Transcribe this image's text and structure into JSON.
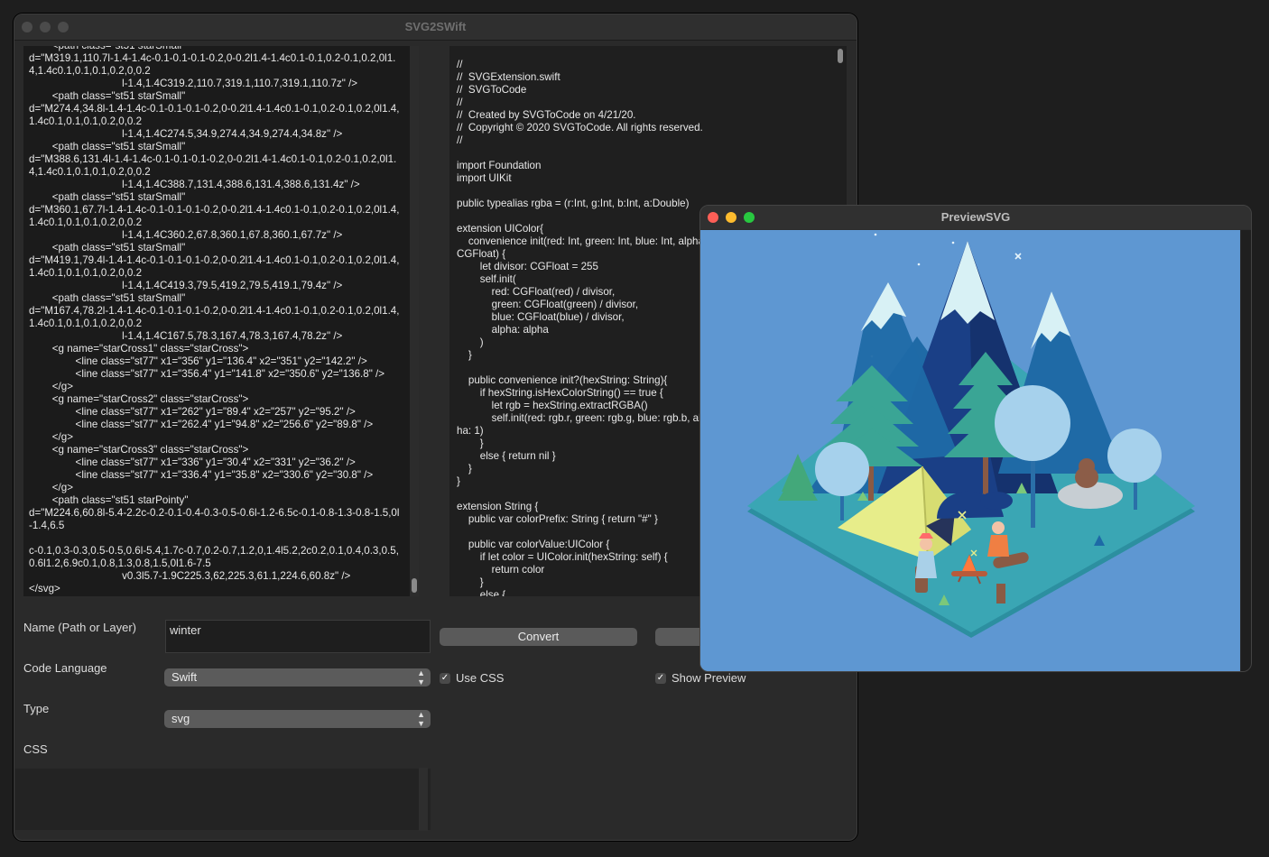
{
  "main_window": {
    "title": "SVG2SWift"
  },
  "svg_source": {
    "text": "\t<path class=\"st51 starSmall\"\nd=\"M319.1,110.7l-1.4-1.4c-0.1-0.1-0.1-0.2,0-0.2l1.4-1.4c0.1-0.1,0.2-0.1,0.2,0l1.4,1.4c0.1,0.1,0.1,0.2,0,0.2\n\t\t\t\tl-1.4,1.4C319.2,110.7,319.1,110.7,319.1,110.7z\" />\n\t<path class=\"st51 starSmall\"\nd=\"M274.4,34.8l-1.4-1.4c-0.1-0.1-0.1-0.2,0-0.2l1.4-1.4c0.1-0.1,0.2-0.1,0.2,0l1.4,1.4c0.1,0.1,0.1,0.2,0,0.2\n\t\t\t\tl-1.4,1.4C274.5,34.9,274.4,34.9,274.4,34.8z\" />\n\t<path class=\"st51 starSmall\"\nd=\"M388.6,131.4l-1.4-1.4c-0.1-0.1-0.1-0.2,0-0.2l1.4-1.4c0.1-0.1,0.2-0.1,0.2,0l1.4,1.4c0.1,0.1,0.1,0.2,0,0.2\n\t\t\t\tl-1.4,1.4C388.7,131.4,388.6,131.4,388.6,131.4z\" />\n\t<path class=\"st51 starSmall\"\nd=\"M360.1,67.7l-1.4-1.4c-0.1-0.1-0.1-0.2,0-0.2l1.4-1.4c0.1-0.1,0.2-0.1,0.2,0l1.4,1.4c0.1,0.1,0.1,0.2,0,0.2\n\t\t\t\tl-1.4,1.4C360.2,67.8,360.1,67.8,360.1,67.7z\" />\n\t<path class=\"st51 starSmall\"\nd=\"M419.1,79.4l-1.4-1.4c-0.1-0.1-0.1-0.2,0-0.2l1.4-1.4c0.1-0.1,0.2-0.1,0.2,0l1.4,1.4c0.1,0.1,0.1,0.2,0,0.2\n\t\t\t\tl-1.4,1.4C419.3,79.5,419.2,79.5,419.1,79.4z\" />\n\t<path class=\"st51 starSmall\"\nd=\"M167.4,78.2l-1.4-1.4c-0.1-0.1-0.1-0.2,0-0.2l1.4-1.4c0.1-0.1,0.2-0.1,0.2,0l1.4,1.4c0.1,0.1,0.1,0.2,0,0.2\n\t\t\t\tl-1.4,1.4C167.5,78.3,167.4,78.3,167.4,78.2z\" />\n\t<g name=\"starCross1\" class=\"starCross\">\n\t\t<line class=\"st77\" x1=\"356\" y1=\"136.4\" x2=\"351\" y2=\"142.2\" />\n\t\t<line class=\"st77\" x1=\"356.4\" y1=\"141.8\" x2=\"350.6\" y2=\"136.8\" />\n\t</g>\n\t<g name=\"starCross2\" class=\"starCross\">\n\t\t<line class=\"st77\" x1=\"262\" y1=\"89.4\" x2=\"257\" y2=\"95.2\" />\n\t\t<line class=\"st77\" x1=\"262.4\" y1=\"94.8\" x2=\"256.6\" y2=\"89.8\" />\n\t</g>\n\t<g name=\"starCross3\" class=\"starCross\">\n\t\t<line class=\"st77\" x1=\"336\" y1=\"30.4\" x2=\"331\" y2=\"36.2\" />\n\t\t<line class=\"st77\" x1=\"336.4\" y1=\"35.8\" x2=\"330.6\" y2=\"30.8\" />\n\t</g>\n\t<path class=\"st51 starPointy\"\nd=\"M224.6,60.8l-5.4-2.2c-0.2-0.1-0.4-0.3-0.5-0.6l-1.2-6.5c-0.1-0.8-1.3-0.8-1.5,0l-1.4,6.5\n\nc-0.1,0.3-0.3,0.5-0.5,0.6l-5.4,1.7c-0.7,0.2-0.7,1.2,0,1.4l5.2,2c0.2,0.1,0.4,0.3,0.5,0.6l1.2,6.9c0.1,0.8,1.3,0.8,1.5,0l1.6-7.5\n\t\t\t\tv0.3l5.7-1.9C225.3,62,225.3,61.1,224.6,60.8z\" />\n</svg>"
  },
  "swift_output": {
    "text": "//\n//  SVGExtension.swift\n//  SVGToCode\n//\n//  Created by SVGToCode on 4/21/20.\n//  Copyright © 2020 SVGToCode. All rights reserved.\n//\n\nimport Foundation\nimport UIKit\n\npublic typealias rgba = (r:Int, g:Int, b:Int, a:Double)\n\nextension UIColor{\n    convenience init(red: Int, green: Int, blue: Int, alpha:CGFloat) {\n        let divisor: CGFloat = 255\n        self.init(\n            red: CGFloat(red) / divisor,\n            green: CGFloat(green) / divisor,\n            blue: CGFloat(blue) / divisor,\n            alpha: alpha\n        )\n    }\n\n    public convenience init?(hexString: String){\n        if hexString.isHexColorString() == true {\n            let rgb = hexString.extractRGBA()\n            self.init(red: rgb.r, green: rgb.g, blue: rgb.b, alpha: 1)\n        }\n        else { return nil }\n    }\n}\n\nextension String {\n    public var colorPrefix: String { return \"#\" }\n\n    public var colorValue:UIColor {\n        if let color = UIColor.init(hexString: self) {\n            return color\n        }\n        else {"
  },
  "form": {
    "name_label": "Name (Path or Layer)",
    "name_value": "winter",
    "language_label": "Code Language",
    "language_value": "Swift",
    "type_label": "Type",
    "type_value": "svg",
    "css_label": "CSS",
    "convert_label": "Convert",
    "use_css_label": "Use CSS",
    "use_css_checked": true,
    "show_preview_label": "Show Preview",
    "show_preview_checked": true,
    "checkmark": "✓"
  },
  "preview_window": {
    "title": "PreviewSVG"
  },
  "colors": {
    "sky": "#5e97d2",
    "ground": "#3aa6b4",
    "mountain_dark": "#1a3f86",
    "mountain_mid": "#1f6aa6",
    "snow": "#d8f1f5",
    "tree": "#3aa595",
    "bubble": "#a6d1ec",
    "tent": "#e7ed8a"
  }
}
